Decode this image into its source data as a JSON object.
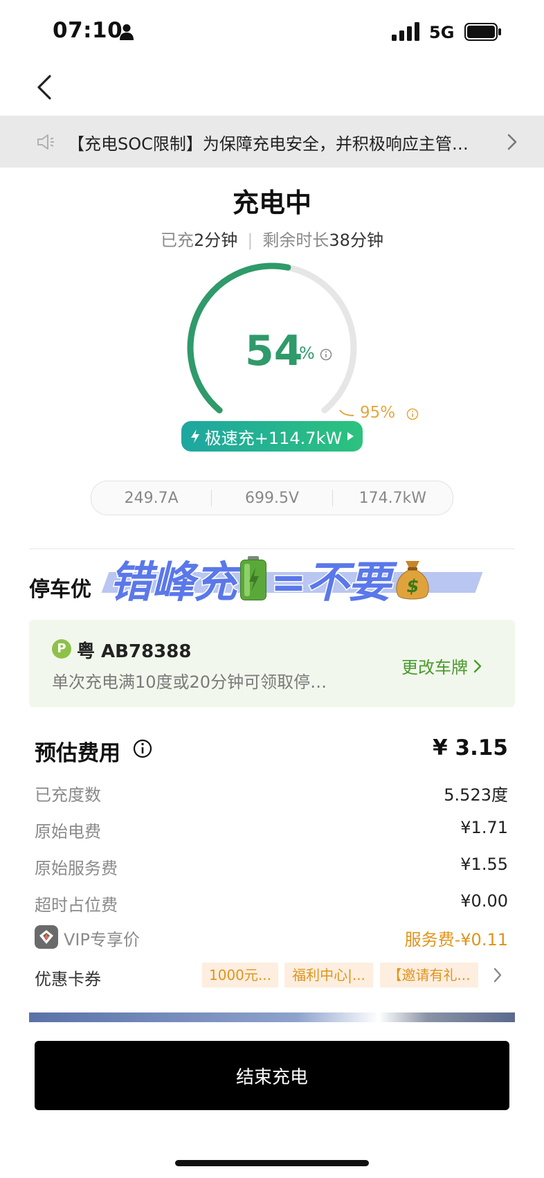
{
  "status_bar": {
    "time": "07:10",
    "network": "5G",
    "icons": [
      "person-icon",
      "signal-icon",
      "battery-icon"
    ]
  },
  "notice": {
    "text": "【充电SOC限制】为保障充电安全，并积极响应主管…"
  },
  "charging": {
    "title": "充电中",
    "charged_label": "已充",
    "charged_value": "2分钟",
    "remaining_label": "剩余时长",
    "remaining_value": "38分钟",
    "soc_value": "54",
    "soc_unit": "%",
    "soc_fraction": 0.54,
    "limit_text": "95%",
    "fast_charge_label": "极速充+114.7kW",
    "colors": {
      "progress": "#2f9a6a",
      "limit": "#e6a63e"
    }
  },
  "metrics": [
    "249.7A",
    "699.5V",
    "174.7kW"
  ],
  "overlay": {
    "text_a": "错峰充",
    "text_b": "=不要"
  },
  "parking": {
    "title": "停车优",
    "badge": "P",
    "plate": "粤 AB78388",
    "description": "单次充电满10度或20分钟可领取停…",
    "change_label": "更改车牌"
  },
  "fees": {
    "title": "预估费用",
    "total": "¥ 3.15",
    "rows": [
      {
        "label": "已充度数",
        "value": "5.523度"
      },
      {
        "label": "原始电费",
        "value": "¥1.71"
      },
      {
        "label": "原始服务费",
        "value": "¥1.55"
      },
      {
        "label": "超时占位费",
        "value": "¥0.00"
      }
    ],
    "vip": {
      "label": "VIP专享价",
      "value": "服务费-¥0.11"
    },
    "coupons_label": "优惠卡券",
    "coupons": [
      "1000元...",
      "福利中心|...",
      "【邀请有礼..."
    ]
  },
  "end_button": "结束充电"
}
